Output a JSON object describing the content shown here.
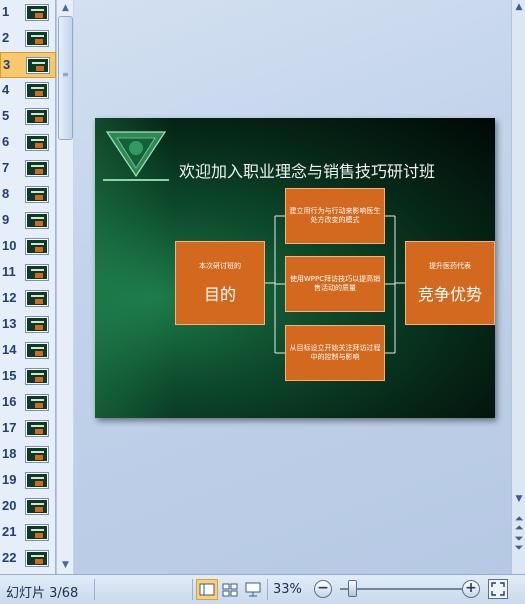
{
  "sidebar": {
    "selected_index": 3,
    "items": [
      {
        "num": "1"
      },
      {
        "num": "2"
      },
      {
        "num": "3"
      },
      {
        "num": "4"
      },
      {
        "num": "5"
      },
      {
        "num": "6"
      },
      {
        "num": "7"
      },
      {
        "num": "8"
      },
      {
        "num": "9"
      },
      {
        "num": "10"
      },
      {
        "num": "11"
      },
      {
        "num": "12"
      },
      {
        "num": "13"
      },
      {
        "num": "14"
      },
      {
        "num": "15"
      },
      {
        "num": "16"
      },
      {
        "num": "17"
      },
      {
        "num": "18"
      },
      {
        "num": "19"
      },
      {
        "num": "20"
      },
      {
        "num": "21"
      },
      {
        "num": "22"
      }
    ]
  },
  "slide": {
    "title": "欢迎加入职业理念与销售技巧研讨班",
    "left_box": {
      "small": "本次研讨班的",
      "big": "目的"
    },
    "right_box": {
      "small": "提升医药代表",
      "big": "竞争优势"
    },
    "mid_boxes": [
      {
        "text": "建立用行为与行动来影响医生处方改变的模式"
      },
      {
        "text": "使用WPPC拜访技巧以提高销售活动的质量"
      },
      {
        "text": "从目标设立开始关注拜访过程中的控制与影响"
      }
    ]
  },
  "status": {
    "slide_counter": "幻灯片 3/68",
    "zoom": "33%",
    "zoom_out": "−",
    "zoom_in": "+"
  },
  "colors": {
    "accent_box": "#d2691e",
    "selected_thumb": "#f7c96a"
  }
}
